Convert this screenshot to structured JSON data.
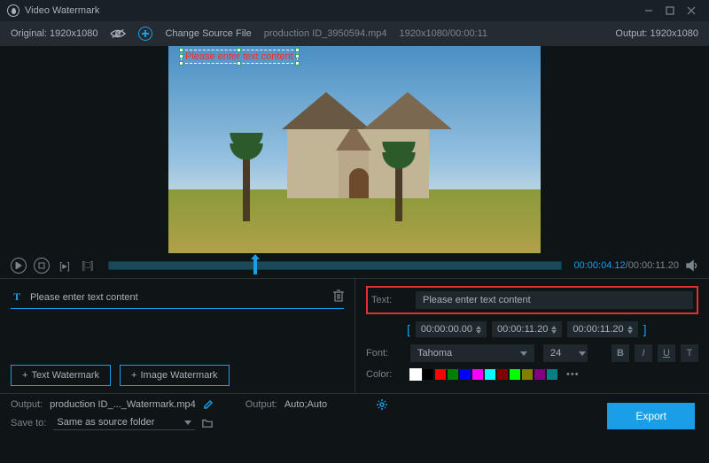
{
  "title": "Video Watermark",
  "topbar": {
    "original_label": "Original:",
    "original_res": "1920x1080",
    "change_source": "Change Source File",
    "filename": "production ID_3950594.mp4",
    "fileinfo": "1920x1080/00:00:11",
    "output_label": "Output:",
    "output_res": "1920x1080"
  },
  "watermark_overlay_text": "Please enter text content",
  "playback": {
    "current": "00:00:04.12",
    "total": "00:00:11.20"
  },
  "watermark_list": {
    "item_text": "Please enter text content"
  },
  "buttons": {
    "text_wm": "Text Watermark",
    "image_wm": "Image Watermark",
    "export": "Export"
  },
  "props": {
    "text_label": "Text:",
    "text_value": "Please enter text content",
    "time_start": "00:00:00.00",
    "time_end": "00:00:11.20",
    "time_dur": "00:00:11.20",
    "font_label": "Font:",
    "font_value": "Tahoma",
    "size_value": "24",
    "color_label": "Color:",
    "style_b": "B",
    "style_i": "I",
    "style_u": "U",
    "style_t": "T"
  },
  "swatches": [
    "#ffffff",
    "#000000",
    "#ff0000",
    "#008000",
    "#0000ff",
    "#ff00ff",
    "#00ffff",
    "#800000",
    "#00ff00",
    "#808000",
    "#800080",
    "#008080"
  ],
  "bottom": {
    "output_label": "Output:",
    "output_file": "production ID_..._Watermark.mp4",
    "output2_label": "Output:",
    "output2_value": "Auto;Auto",
    "saveto_label": "Save to:",
    "saveto_value": "Same as source folder"
  }
}
